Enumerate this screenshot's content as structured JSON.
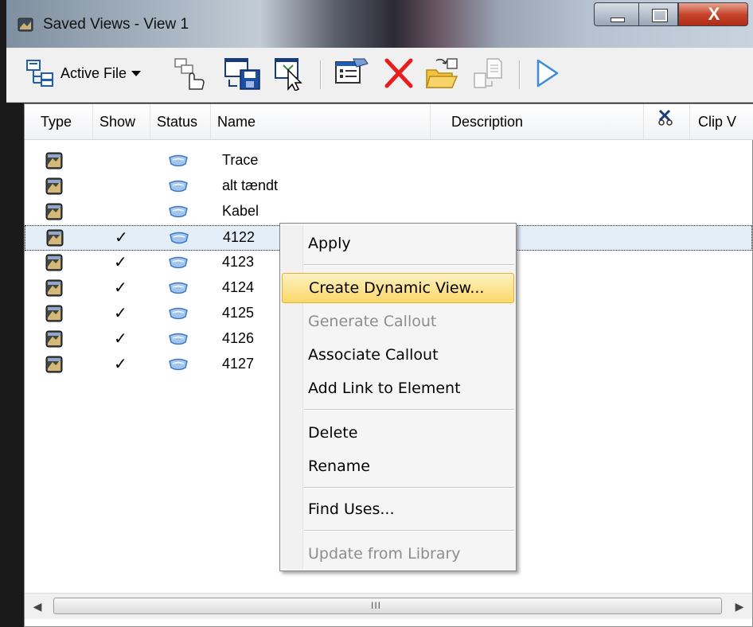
{
  "window": {
    "title": "Saved Views - View 1",
    "controls": {
      "close": "X"
    }
  },
  "toolbar": {
    "active_file_label": "Active File"
  },
  "columns": [
    "Type",
    "Show",
    "Status",
    "Name",
    "Description",
    "Clip V"
  ],
  "rows": [
    {
      "name": "Trace",
      "show": ""
    },
    {
      "name": "alt tændt",
      "show": ""
    },
    {
      "name": "Kabel",
      "show": ""
    },
    {
      "name": "4122",
      "show": "✓",
      "selected": true
    },
    {
      "name": "4123",
      "show": "✓"
    },
    {
      "name": "4124",
      "show": "✓"
    },
    {
      "name": "4125",
      "show": "✓"
    },
    {
      "name": "4126",
      "show": "✓"
    },
    {
      "name": "4127",
      "show": "✓"
    }
  ],
  "scrollbar": {
    "grip": "III"
  },
  "context_menu": {
    "items": [
      {
        "label": "Apply",
        "enabled": true
      },
      {
        "label": "Create Dynamic View...",
        "enabled": true,
        "highlighted": true
      },
      {
        "label": "Generate Callout",
        "enabled": false
      },
      {
        "label": "Associate Callout",
        "enabled": true
      },
      {
        "label": "Add Link to Element",
        "enabled": true
      },
      {
        "label": "Delete",
        "enabled": true
      },
      {
        "label": "Rename",
        "enabled": true
      },
      {
        "label": "Find Uses...",
        "enabled": true
      },
      {
        "label": "Update from Library",
        "enabled": false
      }
    ]
  },
  "colors": {
    "highlight": "#fbd868",
    "delete_icon": "#e81e1e",
    "selection": "#e3eef9"
  }
}
